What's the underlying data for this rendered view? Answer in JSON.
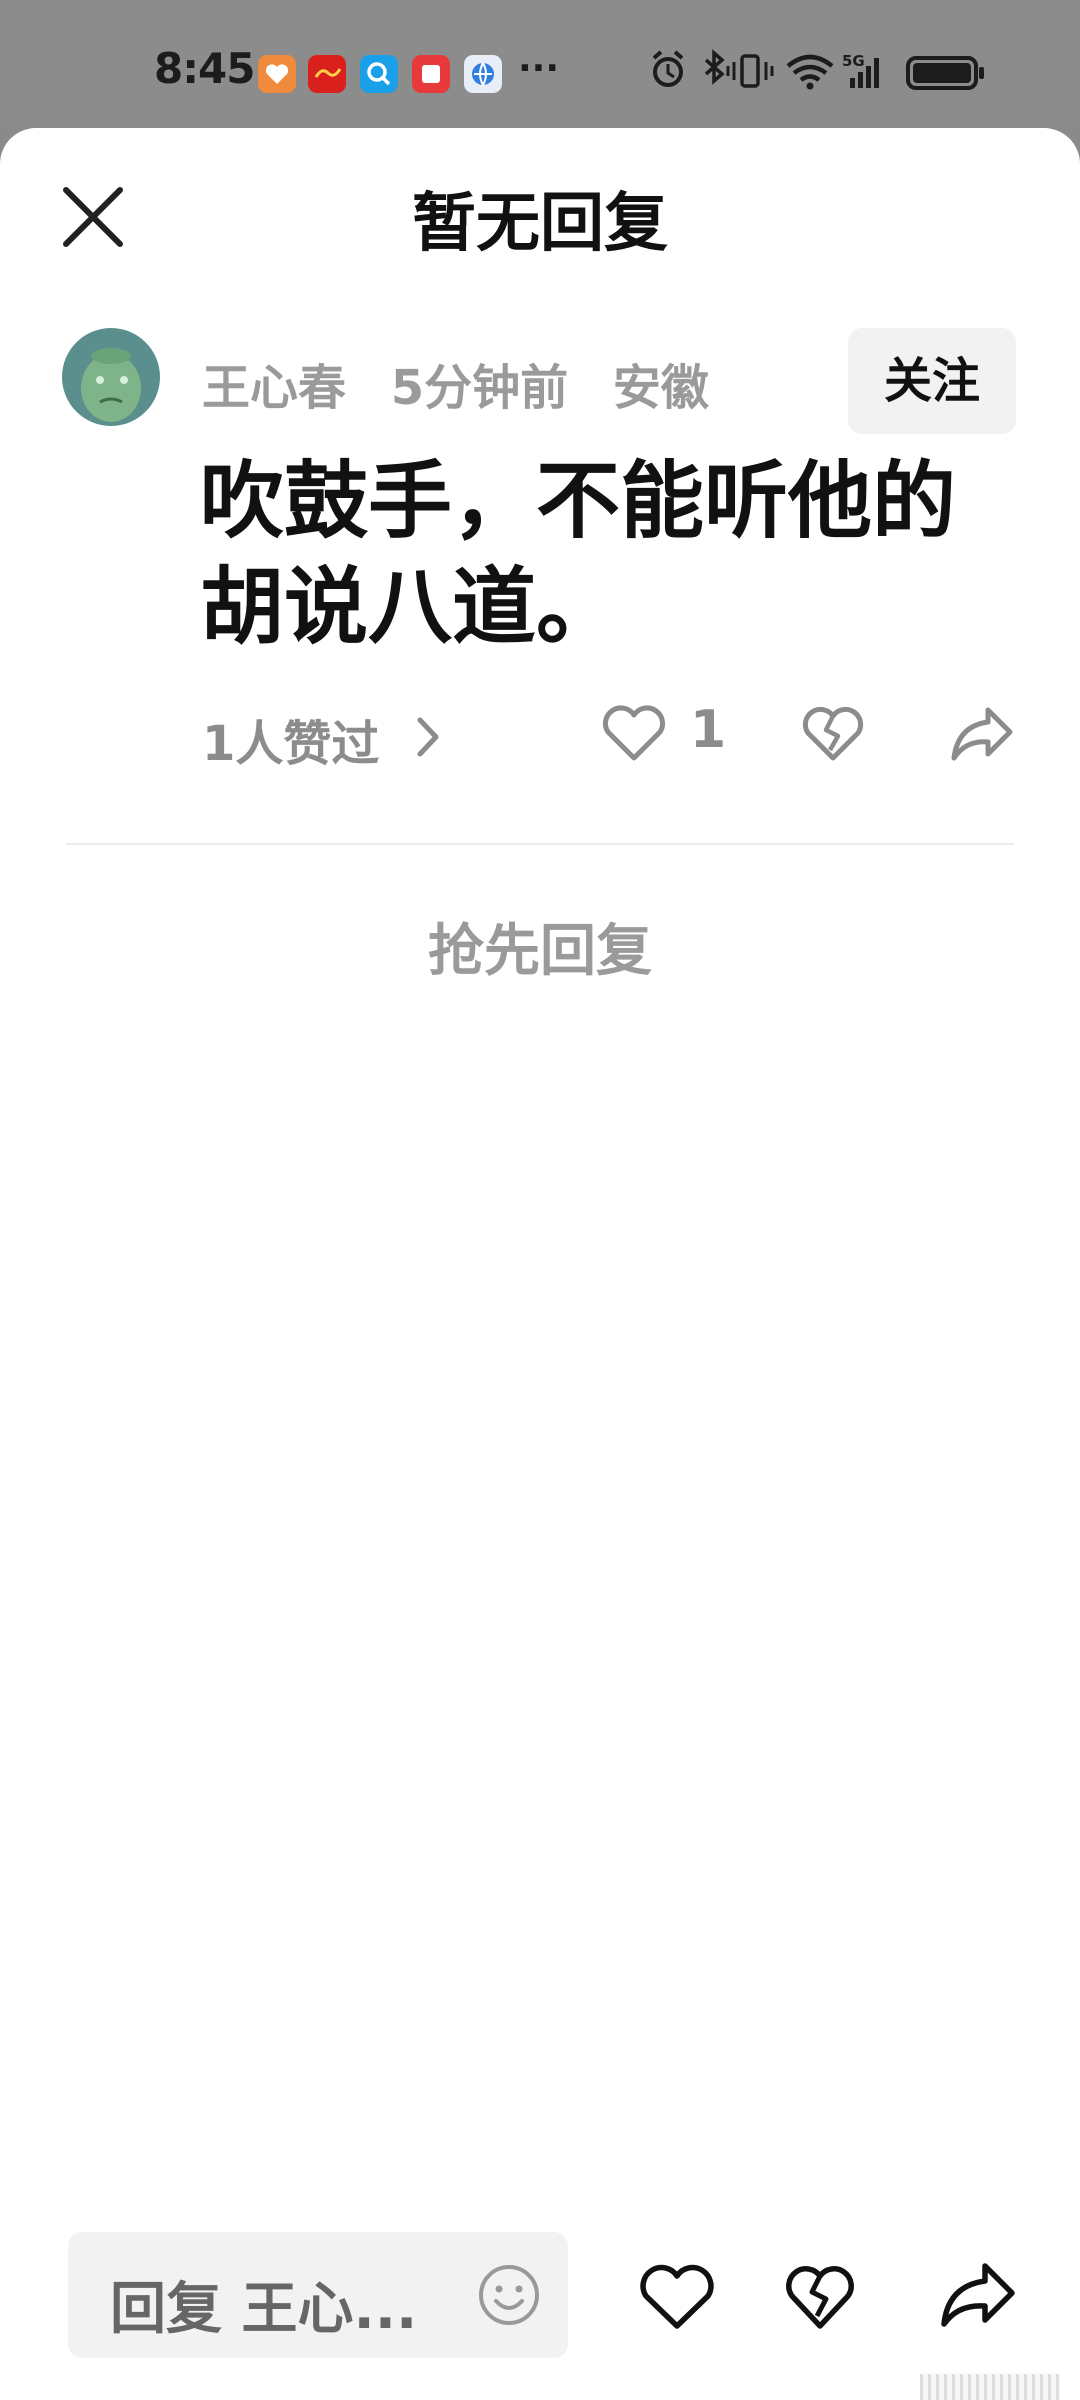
{
  "status_bar": {
    "time": "8:45",
    "more": "···",
    "app_icons": [
      {
        "name": "health-app-icon",
        "color": "#f08a3c"
      },
      {
        "name": "xuexi-app-icon",
        "color": "#d9201c"
      },
      {
        "name": "search-app-icon",
        "color": "#1aa0e8"
      },
      {
        "name": "notes-app-icon",
        "color": "#e83a3a"
      },
      {
        "name": "browser-app-icon",
        "color": "#2f7fe0"
      }
    ],
    "right_icons": [
      "alarm-icon",
      "bluetooth-icon",
      "vibrate-icon",
      "wifi-icon",
      "signal-5g-icon",
      "battery-icon"
    ],
    "network_label": "5G"
  },
  "header": {
    "title": "暂无回复",
    "close_icon": "close-icon"
  },
  "comment": {
    "author": "王心春",
    "time_ago": "5分钟前",
    "location": "安徽",
    "follow_label": "关注",
    "text": "吹鼓手，不能听他的胡说八道。",
    "likes_summary": "1人赞过",
    "like_count": "1"
  },
  "empty_state": {
    "first_reply_label": "抢先回复"
  },
  "bottom_bar": {
    "reply_placeholder": "回复 王心...",
    "emoji_icon": "emoji-icon",
    "like_icon": "heart-icon",
    "dislike_icon": "broken-heart-icon",
    "share_icon": "share-icon"
  },
  "colors": {
    "accent_text": "#111111",
    "muted_text": "#9a9a9a",
    "chip_bg": "#f2f2f2",
    "avatar_bg": "#5a8f8e"
  }
}
